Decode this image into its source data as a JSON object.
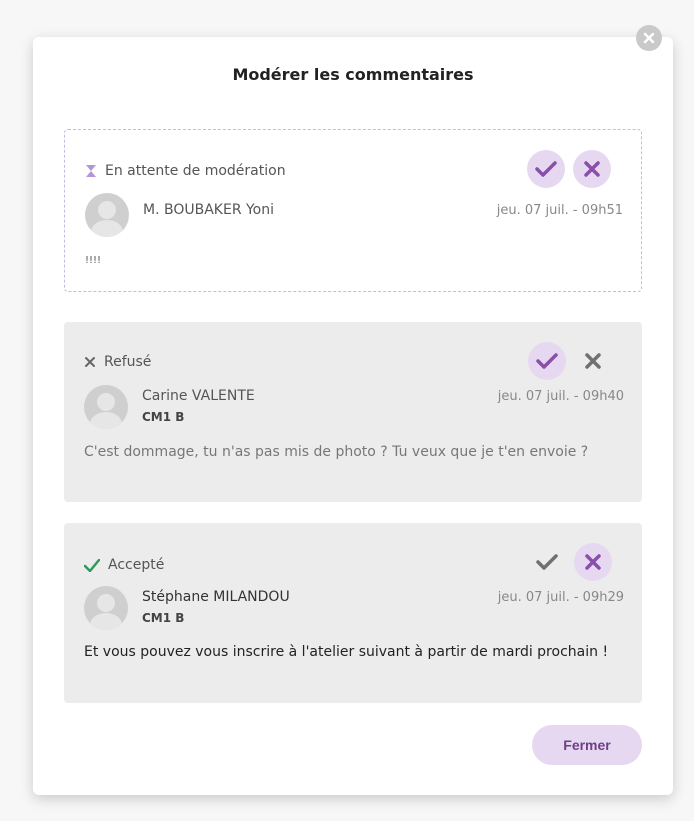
{
  "modal": {
    "title": "Modérer les commentaires",
    "close_button_label": "Fermer"
  },
  "comments": [
    {
      "status": "En attente de modération",
      "author": "M. BOUBAKER Yoni",
      "class": "",
      "date": "jeu. 07 juil. - 09h51",
      "message": "!!!!"
    },
    {
      "status": "Refusé",
      "author": "Carine VALENTE",
      "class": "CM1 B",
      "date": "jeu. 07 juil. - 09h40",
      "message": "C'est dommage, tu n'as pas mis de photo ? Tu veux que je t'en envoie ?"
    },
    {
      "status": "Accepté",
      "author": "Stéphane MILANDOU",
      "class": "CM1 B",
      "date": "jeu. 07 juil. - 09h29",
      "message": "Et vous pouvez vous inscrire à l'atelier suivant à partir de mardi prochain !"
    }
  ],
  "colors": {
    "accent": "#8a4fa8",
    "accent_light": "#e7d8f1",
    "accepted_green": "#2e9a5c",
    "neutral_icon": "#707070"
  },
  "icons": {
    "pending": "hourglass-icon",
    "refused": "cross-icon",
    "accepted": "checkmark-icon",
    "approve": "check-icon",
    "reject": "x-icon",
    "close": "close-circle-icon",
    "avatar": "user-avatar-icon"
  }
}
